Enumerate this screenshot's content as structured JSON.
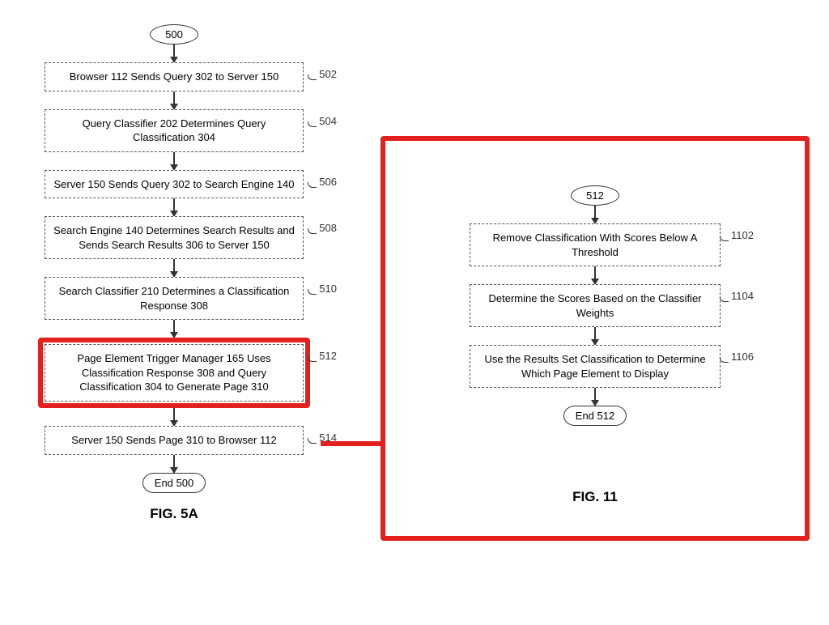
{
  "left": {
    "start": "500",
    "steps": [
      {
        "text": "Browser 112 Sends Query 302 to Server 150",
        "ref": "502"
      },
      {
        "text": "Query Classifier 202 Determines Query Classification 304",
        "ref": "504"
      },
      {
        "text": "Server 150 Sends Query 302 to Search Engine 140",
        "ref": "506"
      },
      {
        "text": "Search Engine 140 Determines Search Results and Sends Search Results 306 to Server 150",
        "ref": "508"
      },
      {
        "text": "Search Classifier 210 Determines a Classification Response 308",
        "ref": "510"
      },
      {
        "text": "Page Element Trigger Manager 165 Uses Classification Response 308 and Query Classification 304 to Generate Page 310",
        "ref": "512",
        "highlight": true
      },
      {
        "text": "Server 150 Sends Page 310 to Browser 112",
        "ref": "514"
      }
    ],
    "end": "End 500",
    "fig": "FIG. 5A"
  },
  "right": {
    "start": "512",
    "steps": [
      {
        "text": "Remove Classification With Scores Below A Threshold",
        "ref": "1102"
      },
      {
        "text": "Determine the Scores Based on the Classifier Weights",
        "ref": "1104"
      },
      {
        "text": "Use the Results Set Classification to Determine Which Page Element to Display",
        "ref": "1106"
      }
    ],
    "end": "End 512",
    "fig": "FIG. 11"
  }
}
